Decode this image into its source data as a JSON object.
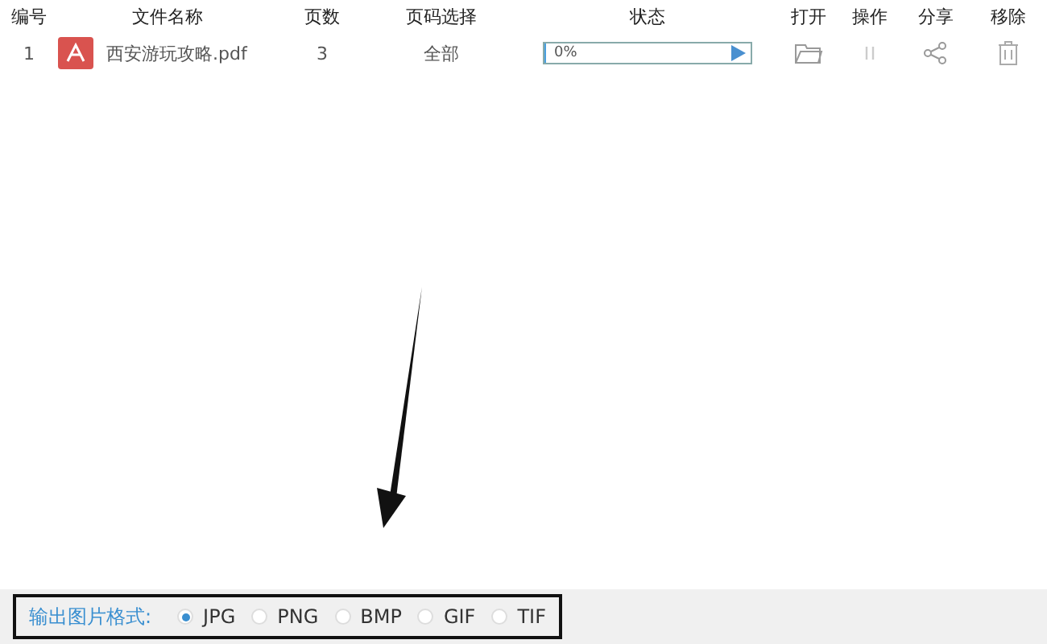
{
  "table": {
    "columns": [
      "编号",
      "文件名称",
      "页数",
      "页码选择",
      "状态",
      "打开",
      "操作",
      "分享",
      "移除"
    ],
    "rows": [
      {
        "number": "1",
        "file_name": "西安游玩攻略.pdf",
        "pages": "3",
        "page_selection": "全部",
        "progress": {
          "level": 0,
          "reading": "0%"
        }
      }
    ]
  },
  "output_format": {
    "label": "输出图片格式:",
    "options": [
      {
        "label": "JPG",
        "selected": true
      },
      {
        "label": "PNG",
        "selected": false
      },
      {
        "label": "BMP",
        "selected": false
      },
      {
        "label": "GIF",
        "selected": false
      },
      {
        "label": "TIF",
        "selected": false
      }
    ]
  }
}
